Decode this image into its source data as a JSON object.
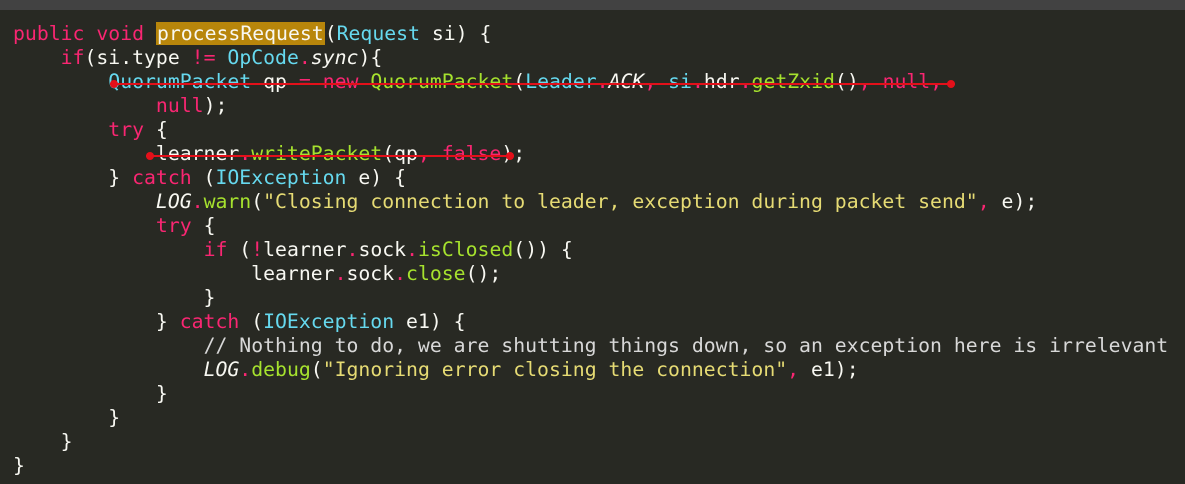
{
  "code": {
    "lines": [
      [
        [
          "public",
          "k"
        ],
        [
          " ",
          "p"
        ],
        [
          "void",
          "k"
        ],
        [
          " ",
          "p"
        ],
        [
          "processRequest",
          "c hl"
        ],
        [
          "(",
          "p"
        ],
        [
          "Request",
          "t"
        ],
        [
          " si) {",
          "p"
        ]
      ],
      [
        [
          "    ",
          "p"
        ],
        [
          "if",
          "k"
        ],
        [
          "(si.type ",
          "p"
        ],
        [
          "!=",
          "k"
        ],
        [
          " ",
          "p"
        ],
        [
          "OpCode",
          "t"
        ],
        [
          ".",
          "k"
        ],
        [
          "sync",
          "i"
        ],
        [
          "){",
          "p"
        ]
      ],
      [
        [
          "        ",
          "p"
        ],
        [
          "QuorumPacket",
          "t"
        ],
        [
          " qp ",
          "p"
        ],
        [
          "=",
          "k"
        ],
        [
          " ",
          "p"
        ],
        [
          "new",
          "k"
        ],
        [
          " ",
          "p"
        ],
        [
          "QuorumPacket",
          "c"
        ],
        [
          "(",
          "p"
        ],
        [
          "Leader",
          "t"
        ],
        [
          ".",
          "k"
        ],
        [
          "ACK",
          "i"
        ],
        [
          ", ",
          "k"
        ],
        [
          "si",
          "t"
        ],
        [
          ".",
          "k"
        ],
        [
          "hdr",
          "p"
        ],
        [
          ".",
          "k"
        ],
        [
          "getZxid",
          "c"
        ],
        [
          "()",
          "p"
        ],
        [
          ", ",
          "k"
        ],
        [
          "null",
          "k"
        ],
        [
          ",",
          "k"
        ]
      ],
      [
        [
          "            ",
          "p"
        ],
        [
          "null",
          "k"
        ],
        [
          ");",
          "p"
        ]
      ],
      [
        [
          "        ",
          "p"
        ],
        [
          "try",
          "k"
        ],
        [
          " {",
          "p"
        ]
      ],
      [
        [
          "            learner",
          "p"
        ],
        [
          ".",
          "k"
        ],
        [
          "writePacket",
          "c"
        ],
        [
          "(qp",
          "p"
        ],
        [
          ", ",
          "k"
        ],
        [
          "false",
          "k"
        ],
        [
          ");",
          "p"
        ]
      ],
      [
        [
          "        } ",
          "p"
        ],
        [
          "catch",
          "k"
        ],
        [
          " (",
          "p"
        ],
        [
          "IOException",
          "t"
        ],
        [
          " e) {",
          "p"
        ]
      ],
      [
        [
          "            ",
          "p"
        ],
        [
          "LOG",
          "i"
        ],
        [
          ".",
          "k"
        ],
        [
          "warn",
          "c"
        ],
        [
          "(",
          "p"
        ],
        [
          "\"Closing connection to leader, exception during packet send\"",
          "s"
        ],
        [
          ", ",
          "k"
        ],
        [
          "e);",
          "p"
        ]
      ],
      [
        [
          "            ",
          "p"
        ],
        [
          "try",
          "k"
        ],
        [
          " {",
          "p"
        ]
      ],
      [
        [
          "                ",
          "p"
        ],
        [
          "if",
          "k"
        ],
        [
          " (",
          "p"
        ],
        [
          "!",
          "k"
        ],
        [
          "learner",
          "p"
        ],
        [
          ".",
          "k"
        ],
        [
          "sock",
          "p"
        ],
        [
          ".",
          "k"
        ],
        [
          "isClosed",
          "c"
        ],
        [
          "()) {",
          "p"
        ]
      ],
      [
        [
          "                    learner",
          "p"
        ],
        [
          ".",
          "k"
        ],
        [
          "sock",
          "p"
        ],
        [
          ".",
          "k"
        ],
        [
          "close",
          "c"
        ],
        [
          "();",
          "p"
        ]
      ],
      [
        [
          "                }",
          "p"
        ]
      ],
      [
        [
          "            } ",
          "p"
        ],
        [
          "catch",
          "k"
        ],
        [
          " (",
          "p"
        ],
        [
          "IOException",
          "t"
        ],
        [
          " e1) {",
          "p"
        ]
      ],
      [
        [
          "                ",
          "p"
        ],
        [
          "// Nothing to do, we are shutting things down, so an exception here is irrelevant",
          "cm"
        ]
      ],
      [
        [
          "                ",
          "p"
        ],
        [
          "LOG",
          "i"
        ],
        [
          ".",
          "k"
        ],
        [
          "debug",
          "c"
        ],
        [
          "(",
          "p"
        ],
        [
          "\"Ignoring error closing the connection\"",
          "s"
        ],
        [
          ", ",
          "k"
        ],
        [
          "e1);",
          "p"
        ]
      ],
      [
        [
          "            }",
          "p"
        ]
      ],
      [
        [
          "        }",
          "p"
        ]
      ],
      [
        [
          "    }",
          "p"
        ]
      ],
      [
        [
          "}",
          "p"
        ]
      ]
    ]
  },
  "colors": {
    "background": "#282923",
    "keyword": "#f92672",
    "type": "#66d9ef",
    "function": "#a6e22e",
    "string": "#e6db74",
    "highlight": "#b8860b",
    "annotation": "#e3101a"
  }
}
